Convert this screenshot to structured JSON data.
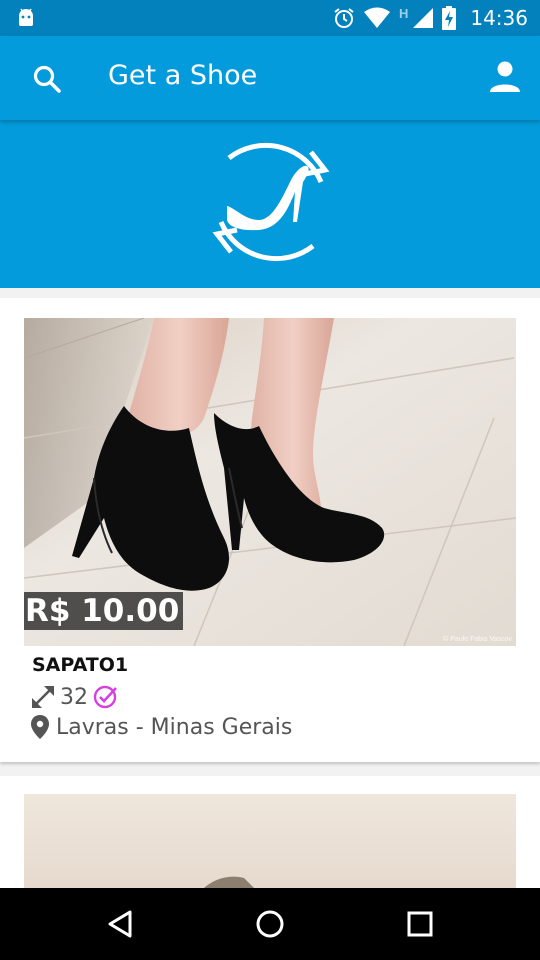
{
  "status_bar": {
    "time": "14:36",
    "network_label": "H",
    "icons": [
      "android-icon",
      "alarm-icon",
      "wifi-icon",
      "signal-icon",
      "battery-icon"
    ]
  },
  "app_bar": {
    "title": "Get a Shoe",
    "icons": [
      "search-icon",
      "account-icon"
    ]
  },
  "hero": {
    "logo": "shoe-exchange-logo"
  },
  "listings": [
    {
      "price": "R$ 10.00",
      "name": "SAPATO1",
      "size": "32",
      "location": "Lavras - Minas Gerais",
      "photo_credit": "© Paulo Fabio Vascov",
      "icons": [
        "resize-arrows-icon",
        "verified-check-icon",
        "location-pin-icon"
      ]
    }
  ],
  "nav_bar": {
    "icons": [
      "back-icon",
      "home-icon",
      "recents-icon"
    ]
  },
  "colors": {
    "status_bar": "#0381bd",
    "app_bar": "#039bdb",
    "verified_accent": "#d63fe0"
  }
}
